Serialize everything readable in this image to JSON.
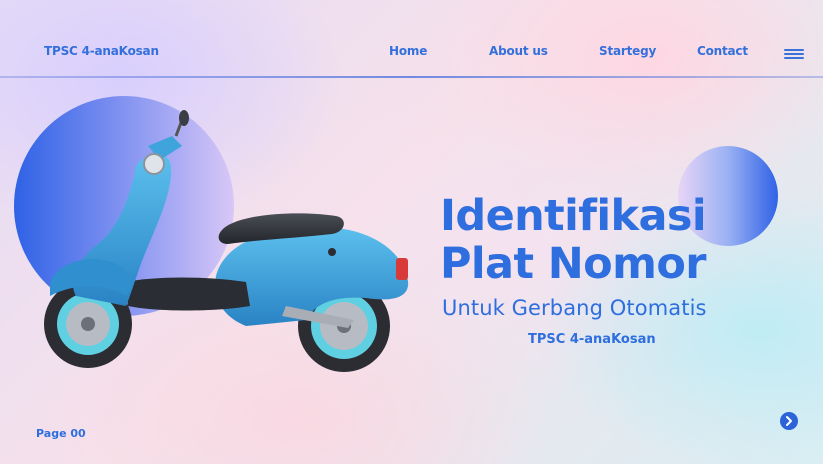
{
  "header": {
    "brand": "TPSC 4-anaKosan",
    "nav": [
      "Home",
      "About us",
      "Startegy",
      "Contact"
    ]
  },
  "hero": {
    "title_line1": "Identifikasi",
    "title_line2": "Plat Nomor",
    "subtitle": "Untuk Gerbang Otomatis",
    "team": "TPSC 4-anaKosan"
  },
  "footer": {
    "page_label": "Page 00"
  },
  "icons": {
    "menu": "hamburger-menu-icon",
    "next": "chevron-right-icon",
    "illustration": "scooter-illustration"
  },
  "colors": {
    "accent": "#2e6ede",
    "scooter_body": "#3a9fd6",
    "scooter_seat": "#2f3238"
  }
}
